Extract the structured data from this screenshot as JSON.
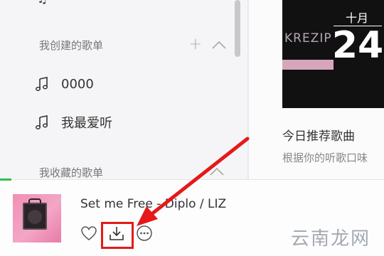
{
  "sidebar": {
    "created_section": {
      "title": "我创建的歌单",
      "add_symbol": "+",
      "icon": "chevron-up-icon"
    },
    "playlists": [
      {
        "label": "0000",
        "icon": "music-note-icon"
      },
      {
        "label": "我最爱听",
        "icon": "music-note-icon"
      }
    ],
    "collected_section": {
      "title": "我收藏的歌单",
      "icon": "chevron-up-icon"
    }
  },
  "recommendation": {
    "month": "十月",
    "day": "24",
    "cover_brand": "KREZIP",
    "title": "今日推荐歌曲",
    "description": "根据你的听歌口味"
  },
  "player": {
    "song": "Set me Free - Diplo / LIZ",
    "controls": [
      {
        "name": "like",
        "icon": "heart-icon"
      },
      {
        "name": "download",
        "icon": "download-icon"
      },
      {
        "name": "more",
        "icon": "more-icon"
      }
    ],
    "progress_fraction": 0.03
  },
  "annotation": {
    "color": "#e5191a"
  },
  "watermark": "云南龙网",
  "colors": {
    "accent_green": "#2fbf53",
    "highlight_red": "#e5191a"
  }
}
